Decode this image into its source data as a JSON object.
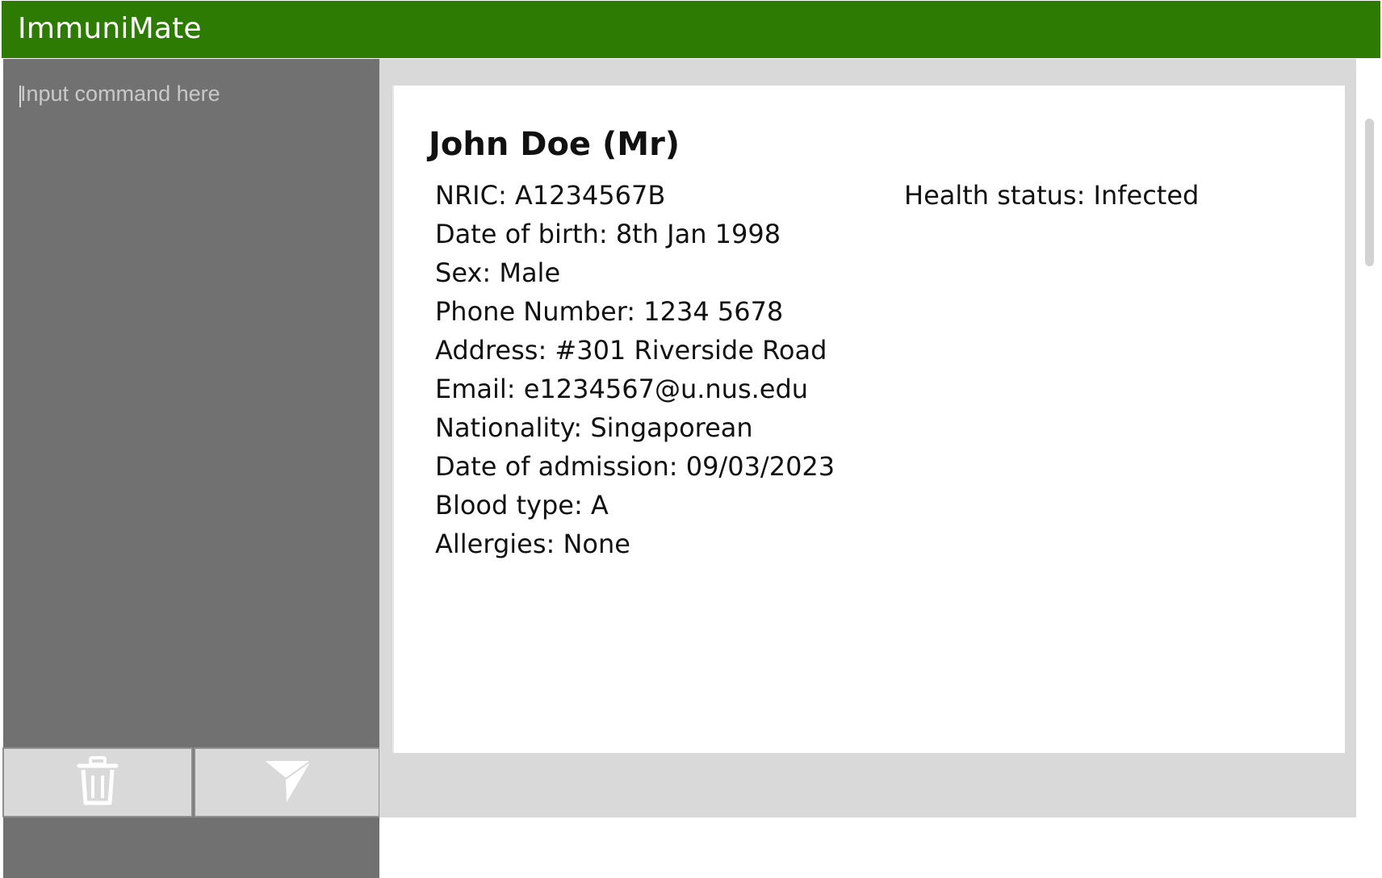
{
  "app": {
    "title": "ImmuniMate"
  },
  "command_box": {
    "placeholder": "Input command here",
    "value": ""
  },
  "buttons": {
    "clear": {
      "icon": "trash-icon"
    },
    "send": {
      "icon": "send-icon"
    }
  },
  "patient": {
    "name": "John Doe (Mr)",
    "health_status": "Health status: Infected",
    "fields": [
      "NRIC: A1234567B",
      "Date of birth: 8th Jan 1998",
      "Sex: Male",
      "Phone Number: 1234 5678",
      "Address: #301 Riverside Road",
      "Email: e1234567@u.nus.edu",
      "Nationality: Singaporean",
      "Date of admission: 09/03/2023",
      "Blood type: A",
      "Allergies: None"
    ]
  },
  "colors": {
    "title_bar": "#2d7b02",
    "command_panel": "#717171",
    "content_background": "#d9d9d9",
    "card": "#ffffff"
  }
}
